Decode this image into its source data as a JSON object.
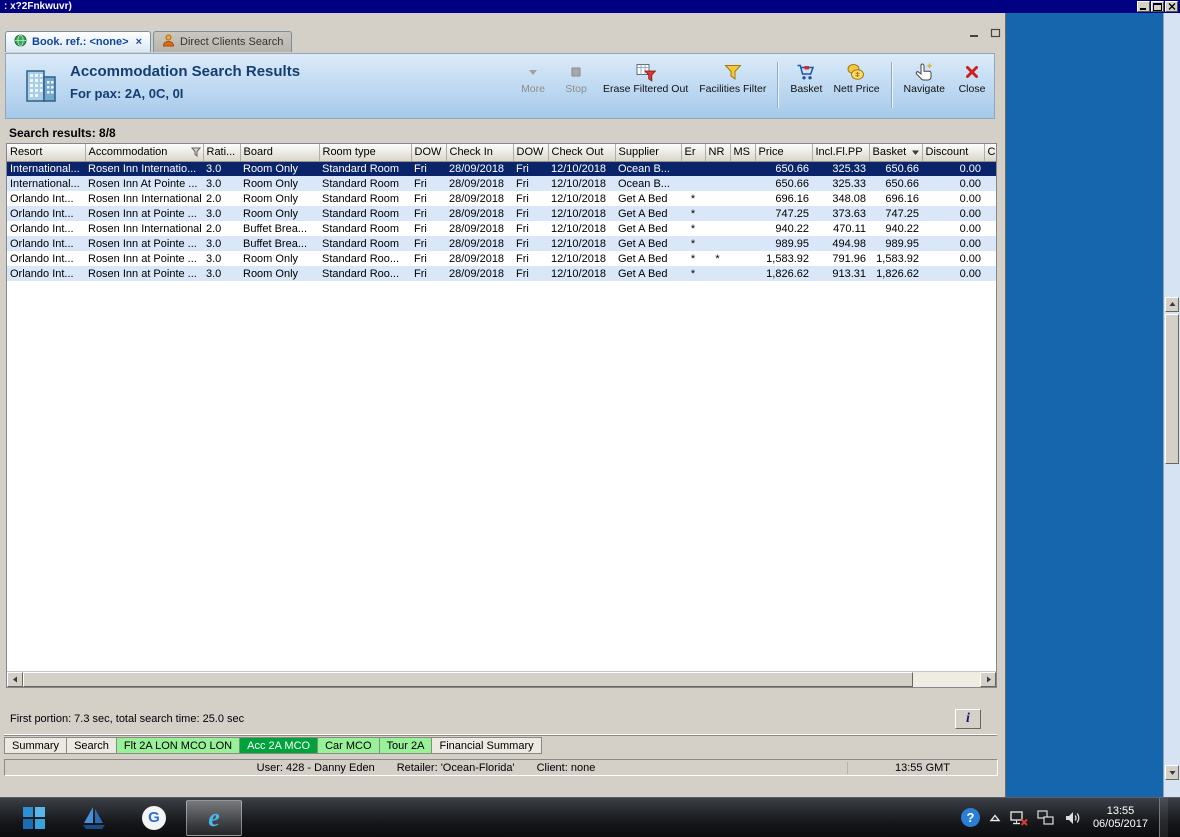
{
  "window": {
    "title": ": x?2Fnkwuvr)"
  },
  "mdi_tabs": [
    {
      "label": "Book. ref.: <none>",
      "icon": "globe",
      "active": true,
      "closable": true
    },
    {
      "label": "Direct Clients Search",
      "icon": "client",
      "active": false,
      "closable": false
    }
  ],
  "header": {
    "title": "Accommodation Search Results",
    "subtitle": "For pax: 2A, 0C, 0I"
  },
  "toolbar": [
    {
      "icon": "more",
      "label": "More",
      "disabled": true
    },
    {
      "icon": "stop",
      "label": "Stop",
      "disabled": true
    },
    {
      "icon": "erase-filter",
      "label": "Erase Filtered Out",
      "disabled": false
    },
    {
      "icon": "facilities-filter",
      "label": "Facilities Filter",
      "disabled": false,
      "sep_after": true
    },
    {
      "icon": "basket",
      "label": "Basket",
      "disabled": false
    },
    {
      "icon": "nett-price",
      "label": "Nett Price",
      "disabled": false,
      "sep_after": true
    },
    {
      "icon": "navigate",
      "label": "Navigate",
      "disabled": false
    },
    {
      "icon": "close-red",
      "label": "Close",
      "disabled": false
    }
  ],
  "results": {
    "summary": "Search results: 8/8",
    "columns": [
      {
        "label": "Resort"
      },
      {
        "label": "Accommodation",
        "filter": true
      },
      {
        "label": "Rati..."
      },
      {
        "label": "Board"
      },
      {
        "label": "Room type"
      },
      {
        "label": "DOW"
      },
      {
        "label": "Check In"
      },
      {
        "label": "DOW"
      },
      {
        "label": "Check Out"
      },
      {
        "label": "Supplier"
      },
      {
        "label": "Er"
      },
      {
        "label": "NR"
      },
      {
        "label": "MS"
      },
      {
        "label": "Price"
      },
      {
        "label": "Incl.Fl.PP"
      },
      {
        "label": "Basket",
        "sort": true
      },
      {
        "label": "Discount"
      },
      {
        "label": "C"
      }
    ],
    "rows": [
      {
        "selected": true,
        "cells": [
          "International...",
          "Rosen Inn Internatio...",
          "3.0",
          "Room Only",
          "Standard Room",
          "Fri",
          "28/09/2018",
          "Fri",
          "12/10/2018",
          "Ocean B...",
          "",
          "",
          "",
          "650.66",
          "325.33",
          "650.66",
          "0.00",
          ""
        ]
      },
      {
        "selected": false,
        "cells": [
          "International...",
          "Rosen Inn At Pointe ...",
          "3.0",
          "Room Only",
          "Standard Room",
          "Fri",
          "28/09/2018",
          "Fri",
          "12/10/2018",
          "Ocean B...",
          "",
          "",
          "",
          "650.66",
          "325.33",
          "650.66",
          "0.00",
          ""
        ]
      },
      {
        "selected": false,
        "cells": [
          "Orlando Int...",
          "Rosen Inn International",
          "2.0",
          "Room Only",
          "Standard Room",
          "Fri",
          "28/09/2018",
          "Fri",
          "12/10/2018",
          "Get A Bed",
          "*",
          "",
          "",
          "696.16",
          "348.08",
          "696.16",
          "0.00",
          ""
        ]
      },
      {
        "selected": false,
        "cells": [
          "Orlando Int...",
          "Rosen Inn at Pointe ...",
          "3.0",
          "Room Only",
          "Standard Room",
          "Fri",
          "28/09/2018",
          "Fri",
          "12/10/2018",
          "Get A Bed",
          "*",
          "",
          "",
          "747.25",
          "373.63",
          "747.25",
          "0.00",
          ""
        ]
      },
      {
        "selected": false,
        "cells": [
          "Orlando Int...",
          "Rosen Inn International",
          "2.0",
          "Buffet Brea...",
          "Standard Room",
          "Fri",
          "28/09/2018",
          "Fri",
          "12/10/2018",
          "Get A Bed",
          "*",
          "",
          "",
          "940.22",
          "470.11",
          "940.22",
          "0.00",
          ""
        ]
      },
      {
        "selected": false,
        "cells": [
          "Orlando Int...",
          "Rosen Inn at Pointe ...",
          "3.0",
          "Buffet Brea...",
          "Standard Room",
          "Fri",
          "28/09/2018",
          "Fri",
          "12/10/2018",
          "Get A Bed",
          "*",
          "",
          "",
          "989.95",
          "494.98",
          "989.95",
          "0.00",
          ""
        ]
      },
      {
        "selected": false,
        "cells": [
          "Orlando Int...",
          "Rosen Inn at Pointe ...",
          "3.0",
          "Room Only",
          "Standard Roo...",
          "Fri",
          "28/09/2018",
          "Fri",
          "12/10/2018",
          "Get A Bed",
          "*",
          "*",
          "",
          "1,583.92",
          "791.96",
          "1,583.92",
          "0.00",
          ""
        ]
      },
      {
        "selected": false,
        "cells": [
          "Orlando Int...",
          "Rosen Inn at Pointe ...",
          "3.0",
          "Room Only",
          "Standard Roo...",
          "Fri",
          "28/09/2018",
          "Fri",
          "12/10/2018",
          "Get A Bed",
          "*",
          "",
          "",
          "1,826.62",
          "913.31",
          "1,826.62",
          "0.00",
          ""
        ]
      }
    ]
  },
  "status": {
    "timing": "First portion: 7.3 sec, total search time: 25.0 sec",
    "info_label": "i"
  },
  "bottom_tabs": [
    {
      "label": "Summary",
      "style": "plain"
    },
    {
      "label": "Search",
      "style": "plain"
    },
    {
      "label": "Flt 2A LON MCO LON",
      "style": "green"
    },
    {
      "label": "Acc 2A MCO",
      "style": "green-selected"
    },
    {
      "label": "Car MCO",
      "style": "green"
    },
    {
      "label": "Tour 2A",
      "style": "green"
    },
    {
      "label": "Financial Summary",
      "style": "plain"
    }
  ],
  "statusbar": {
    "user": "User: 428 - Danny Eden",
    "retailer": "Retailer: 'Ocean-Florida'",
    "client": "Client: none",
    "time": "13:55 GMT"
  },
  "taskbar": {
    "apps": [
      {
        "icon": "windows-logo",
        "active": false
      },
      {
        "icon": "sailboat",
        "active": false
      },
      {
        "icon": "chrome-g",
        "active": false
      },
      {
        "icon": "ie-e",
        "active": true
      }
    ],
    "tray_icons": [
      "help",
      "hidden",
      "net-x",
      "net",
      "vol"
    ],
    "clock_time": "13:55",
    "clock_date": "06/05/2017"
  }
}
